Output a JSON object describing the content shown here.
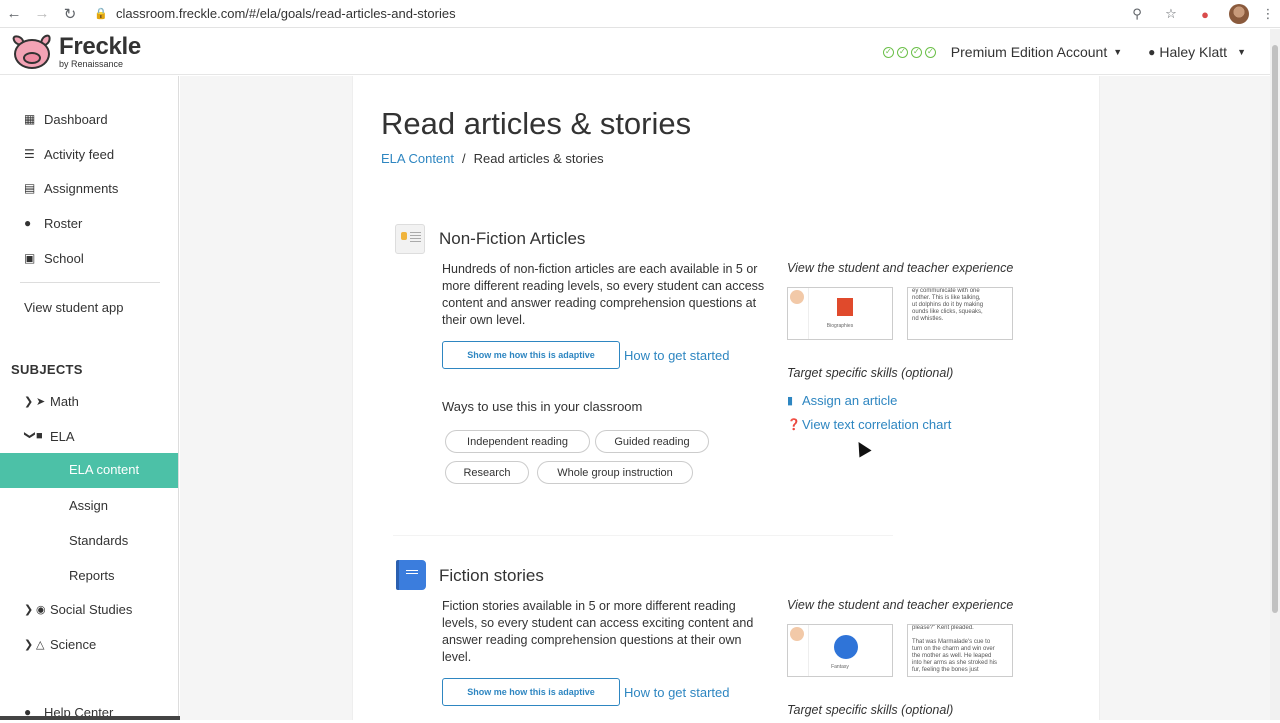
{
  "browser": {
    "url": "classroom.freckle.com/#/ela/goals/read-articles-and-stories"
  },
  "header": {
    "logo_name": "Freckle",
    "logo_sub": "by Renaissance",
    "account": "Premium Edition Account",
    "user": "Haley Klatt"
  },
  "sidebar": {
    "items": [
      {
        "label": "Dashboard",
        "icon": "map-icon"
      },
      {
        "label": "Activity feed",
        "icon": "list-icon"
      },
      {
        "label": "Assignments",
        "icon": "briefcase-icon"
      },
      {
        "label": "Roster",
        "icon": "users-icon"
      },
      {
        "label": "School",
        "icon": "bank-icon"
      }
    ],
    "student_app": "View student app",
    "subjects_title": "SUBJECTS",
    "subjects": [
      {
        "label": "Math",
        "icon": "rocket-icon"
      },
      {
        "label": "ELA",
        "icon": "book-icon"
      },
      {
        "label": "Social Studies",
        "icon": "globe-icon"
      },
      {
        "label": "Science",
        "icon": "flask-icon"
      }
    ],
    "ela_items": [
      "ELA content",
      "Assign",
      "Standards",
      "Reports"
    ],
    "help": "Help Center"
  },
  "main": {
    "title": "Read articles & stories",
    "breadcrumb": {
      "link": "ELA Content",
      "separator": "/",
      "current": "Read articles & stories"
    },
    "sections": [
      {
        "title": "Non-Fiction Articles",
        "description": "Hundreds of non-fiction articles are each available in 5 or more different reading levels, so every student can access content and answer reading comprehension questions at their own level.",
        "adaptive_button": "Show me how this is adaptive",
        "get_started": "How to get started",
        "ways_title": "Ways to use this in your classroom",
        "pills": [
          "Independent reading",
          "Guided reading",
          "Research",
          "Whole group instruction"
        ],
        "view_experience": "View the student and teacher experience",
        "thumb_caption": "Biographies",
        "thumb_text": "ey communicate with one\nnother. This is like talking,\nut dolphins do it by making\nounds like clicks, squeaks,\nnd whistles.",
        "target_title": "Target specific skills (optional)",
        "assign_link": "Assign an article",
        "chart_link": "View text correlation chart"
      },
      {
        "title": "Fiction stories",
        "description": "Fiction stories available in 5 or more different reading levels, so every student can access exciting content and answer reading comprehension questions at their own level.",
        "adaptive_button": "Show me how this is adaptive",
        "get_started": "How to get started",
        "view_experience": "View the student and teacher experience",
        "thumb_caption": "Fantasy",
        "thumb_text": "please?\" Kent pleaded.\n\nThat was Marmalade's cue to\nturn on the charm and win over\nthe mother as well. He leaped\ninto her arms as she stroked his\nfur, feeling the bones just",
        "target_title": "Target specific skills (optional)"
      }
    ]
  }
}
